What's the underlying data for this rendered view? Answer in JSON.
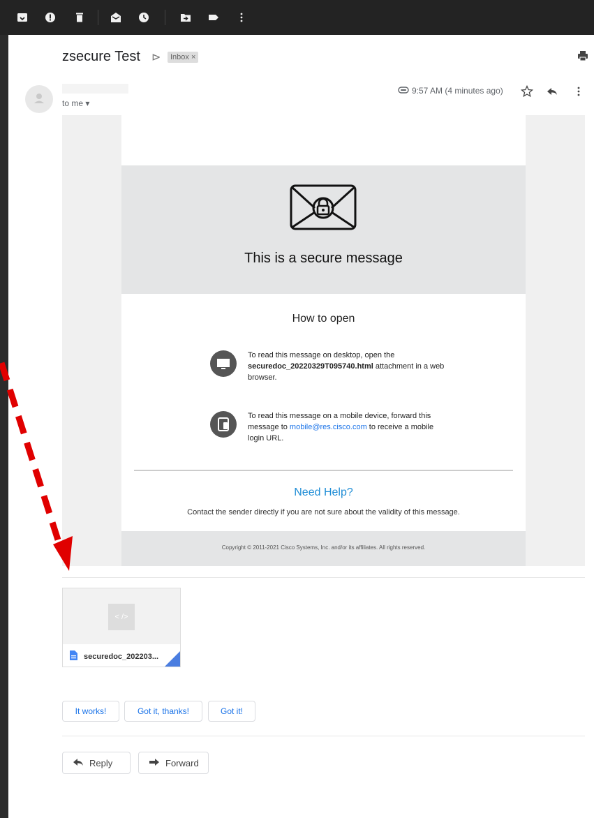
{
  "toolbar": {
    "icons": [
      "archive-icon",
      "report-spam-icon",
      "delete-icon",
      "mark-unread-icon",
      "snooze-icon",
      "move-to-icon",
      "label-icon",
      "more-vert-icon"
    ]
  },
  "message": {
    "subject": "zsecure Test",
    "label": "Inbox ×",
    "to": "to me ▾",
    "time": "9:57 AM (4 minutes ago)"
  },
  "secure": {
    "title": "This is a secure message",
    "how_to_open": "How to open",
    "desktop_pre": "To read this message on desktop, open the ",
    "desktop_file": "securedoc_20220329T095740.html",
    "desktop_post": " attachment in a web browser.",
    "mobile_pre": "To read this message on a mobile device, forward this message to ",
    "mobile_link": "mobile@res.cisco.com",
    "mobile_post": " to receive a mobile login URL.",
    "need_help": "Need Help?",
    "contact": "Contact the sender directly if you are not sure about the validity of this message.",
    "copyright": "Copyright © 2011-2021 Cisco Systems, Inc. and/or its affiliates. All rights reserved."
  },
  "attachment": {
    "preview_label": "< />",
    "name": "securedoc_202203..."
  },
  "smart_replies": [
    "It works!",
    "Got it, thanks!",
    "Got it!"
  ],
  "actions": {
    "reply": "Reply",
    "forward": "Forward"
  },
  "colors": {
    "link": "#1a73e8",
    "need_help": "#1f8dd6",
    "annotation_arrow": "#e00000"
  }
}
